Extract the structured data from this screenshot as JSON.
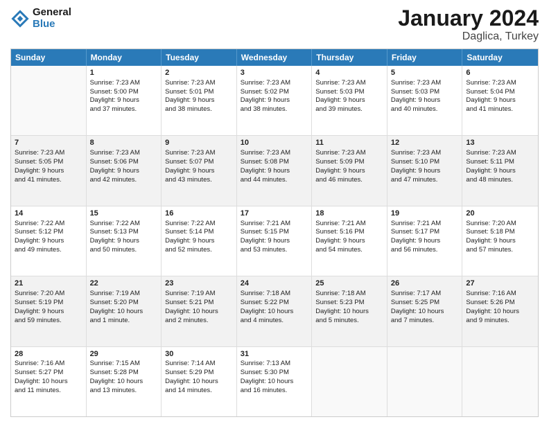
{
  "header": {
    "logo_general": "General",
    "logo_blue": "Blue",
    "month_title": "January 2024",
    "location": "Daglica, Turkey"
  },
  "weekdays": [
    "Sunday",
    "Monday",
    "Tuesday",
    "Wednesday",
    "Thursday",
    "Friday",
    "Saturday"
  ],
  "weeks": [
    {
      "shaded": false,
      "days": [
        {
          "num": "",
          "empty": true,
          "lines": []
        },
        {
          "num": "1",
          "empty": false,
          "lines": [
            "Sunrise: 7:23 AM",
            "Sunset: 5:00 PM",
            "Daylight: 9 hours",
            "and 37 minutes."
          ]
        },
        {
          "num": "2",
          "empty": false,
          "lines": [
            "Sunrise: 7:23 AM",
            "Sunset: 5:01 PM",
            "Daylight: 9 hours",
            "and 38 minutes."
          ]
        },
        {
          "num": "3",
          "empty": false,
          "lines": [
            "Sunrise: 7:23 AM",
            "Sunset: 5:02 PM",
            "Daylight: 9 hours",
            "and 38 minutes."
          ]
        },
        {
          "num": "4",
          "empty": false,
          "lines": [
            "Sunrise: 7:23 AM",
            "Sunset: 5:03 PM",
            "Daylight: 9 hours",
            "and 39 minutes."
          ]
        },
        {
          "num": "5",
          "empty": false,
          "lines": [
            "Sunrise: 7:23 AM",
            "Sunset: 5:03 PM",
            "Daylight: 9 hours",
            "and 40 minutes."
          ]
        },
        {
          "num": "6",
          "empty": false,
          "lines": [
            "Sunrise: 7:23 AM",
            "Sunset: 5:04 PM",
            "Daylight: 9 hours",
            "and 41 minutes."
          ]
        }
      ]
    },
    {
      "shaded": true,
      "days": [
        {
          "num": "7",
          "empty": false,
          "lines": [
            "Sunrise: 7:23 AM",
            "Sunset: 5:05 PM",
            "Daylight: 9 hours",
            "and 41 minutes."
          ]
        },
        {
          "num": "8",
          "empty": false,
          "lines": [
            "Sunrise: 7:23 AM",
            "Sunset: 5:06 PM",
            "Daylight: 9 hours",
            "and 42 minutes."
          ]
        },
        {
          "num": "9",
          "empty": false,
          "lines": [
            "Sunrise: 7:23 AM",
            "Sunset: 5:07 PM",
            "Daylight: 9 hours",
            "and 43 minutes."
          ]
        },
        {
          "num": "10",
          "empty": false,
          "lines": [
            "Sunrise: 7:23 AM",
            "Sunset: 5:08 PM",
            "Daylight: 9 hours",
            "and 44 minutes."
          ]
        },
        {
          "num": "11",
          "empty": false,
          "lines": [
            "Sunrise: 7:23 AM",
            "Sunset: 5:09 PM",
            "Daylight: 9 hours",
            "and 46 minutes."
          ]
        },
        {
          "num": "12",
          "empty": false,
          "lines": [
            "Sunrise: 7:23 AM",
            "Sunset: 5:10 PM",
            "Daylight: 9 hours",
            "and 47 minutes."
          ]
        },
        {
          "num": "13",
          "empty": false,
          "lines": [
            "Sunrise: 7:23 AM",
            "Sunset: 5:11 PM",
            "Daylight: 9 hours",
            "and 48 minutes."
          ]
        }
      ]
    },
    {
      "shaded": false,
      "days": [
        {
          "num": "14",
          "empty": false,
          "lines": [
            "Sunrise: 7:22 AM",
            "Sunset: 5:12 PM",
            "Daylight: 9 hours",
            "and 49 minutes."
          ]
        },
        {
          "num": "15",
          "empty": false,
          "lines": [
            "Sunrise: 7:22 AM",
            "Sunset: 5:13 PM",
            "Daylight: 9 hours",
            "and 50 minutes."
          ]
        },
        {
          "num": "16",
          "empty": false,
          "lines": [
            "Sunrise: 7:22 AM",
            "Sunset: 5:14 PM",
            "Daylight: 9 hours",
            "and 52 minutes."
          ]
        },
        {
          "num": "17",
          "empty": false,
          "lines": [
            "Sunrise: 7:21 AM",
            "Sunset: 5:15 PM",
            "Daylight: 9 hours",
            "and 53 minutes."
          ]
        },
        {
          "num": "18",
          "empty": false,
          "lines": [
            "Sunrise: 7:21 AM",
            "Sunset: 5:16 PM",
            "Daylight: 9 hours",
            "and 54 minutes."
          ]
        },
        {
          "num": "19",
          "empty": false,
          "lines": [
            "Sunrise: 7:21 AM",
            "Sunset: 5:17 PM",
            "Daylight: 9 hours",
            "and 56 minutes."
          ]
        },
        {
          "num": "20",
          "empty": false,
          "lines": [
            "Sunrise: 7:20 AM",
            "Sunset: 5:18 PM",
            "Daylight: 9 hours",
            "and 57 minutes."
          ]
        }
      ]
    },
    {
      "shaded": true,
      "days": [
        {
          "num": "21",
          "empty": false,
          "lines": [
            "Sunrise: 7:20 AM",
            "Sunset: 5:19 PM",
            "Daylight: 9 hours",
            "and 59 minutes."
          ]
        },
        {
          "num": "22",
          "empty": false,
          "lines": [
            "Sunrise: 7:19 AM",
            "Sunset: 5:20 PM",
            "Daylight: 10 hours",
            "and 1 minute."
          ]
        },
        {
          "num": "23",
          "empty": false,
          "lines": [
            "Sunrise: 7:19 AM",
            "Sunset: 5:21 PM",
            "Daylight: 10 hours",
            "and 2 minutes."
          ]
        },
        {
          "num": "24",
          "empty": false,
          "lines": [
            "Sunrise: 7:18 AM",
            "Sunset: 5:22 PM",
            "Daylight: 10 hours",
            "and 4 minutes."
          ]
        },
        {
          "num": "25",
          "empty": false,
          "lines": [
            "Sunrise: 7:18 AM",
            "Sunset: 5:23 PM",
            "Daylight: 10 hours",
            "and 5 minutes."
          ]
        },
        {
          "num": "26",
          "empty": false,
          "lines": [
            "Sunrise: 7:17 AM",
            "Sunset: 5:25 PM",
            "Daylight: 10 hours",
            "and 7 minutes."
          ]
        },
        {
          "num": "27",
          "empty": false,
          "lines": [
            "Sunrise: 7:16 AM",
            "Sunset: 5:26 PM",
            "Daylight: 10 hours",
            "and 9 minutes."
          ]
        }
      ]
    },
    {
      "shaded": false,
      "days": [
        {
          "num": "28",
          "empty": false,
          "lines": [
            "Sunrise: 7:16 AM",
            "Sunset: 5:27 PM",
            "Daylight: 10 hours",
            "and 11 minutes."
          ]
        },
        {
          "num": "29",
          "empty": false,
          "lines": [
            "Sunrise: 7:15 AM",
            "Sunset: 5:28 PM",
            "Daylight: 10 hours",
            "and 13 minutes."
          ]
        },
        {
          "num": "30",
          "empty": false,
          "lines": [
            "Sunrise: 7:14 AM",
            "Sunset: 5:29 PM",
            "Daylight: 10 hours",
            "and 14 minutes."
          ]
        },
        {
          "num": "31",
          "empty": false,
          "lines": [
            "Sunrise: 7:13 AM",
            "Sunset: 5:30 PM",
            "Daylight: 10 hours",
            "and 16 minutes."
          ]
        },
        {
          "num": "",
          "empty": true,
          "lines": []
        },
        {
          "num": "",
          "empty": true,
          "lines": []
        },
        {
          "num": "",
          "empty": true,
          "lines": []
        }
      ]
    }
  ]
}
